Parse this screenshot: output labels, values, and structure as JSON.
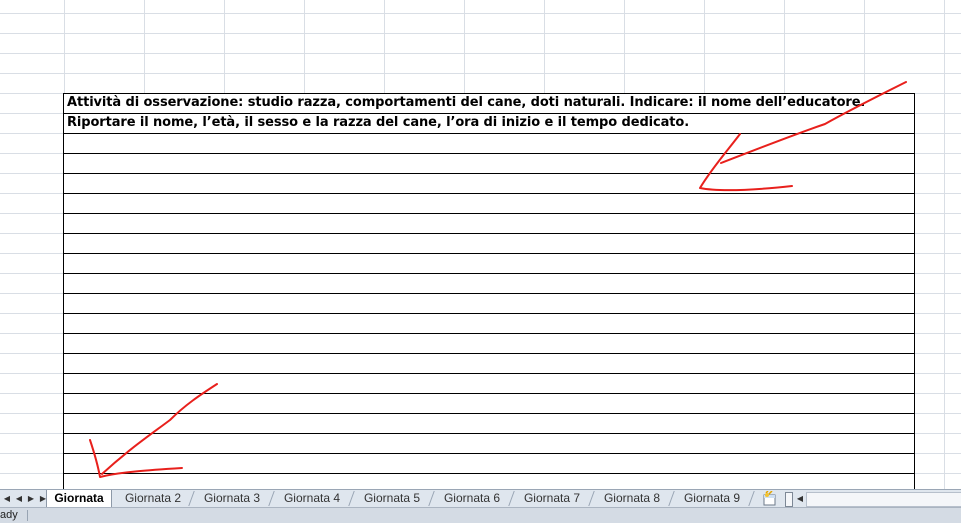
{
  "sheet": {
    "rows": [
      "Attività di osservazione: studio razza, comportamenti del cane, doti naturali. Indicare: il nome dell’educatore.",
      "Riportare il nome, l’età, il sesso e la razza del cane, l’ora di inizio e il tempo dedicato."
    ],
    "blank_row_count": 17
  },
  "annotations": {
    "arrow_color": "#e8201c"
  },
  "tabs": {
    "active": "Giornata",
    "items": [
      "Giornata 2",
      "Giornata 3",
      "Giornata 4",
      "Giornata 5",
      "Giornata 6",
      "Giornata 7",
      "Giornata 8",
      "Giornata 9"
    ],
    "nav": [
      "◀◀",
      "◀",
      "▶",
      "▶▶"
    ]
  },
  "status": {
    "text": "ady"
  }
}
